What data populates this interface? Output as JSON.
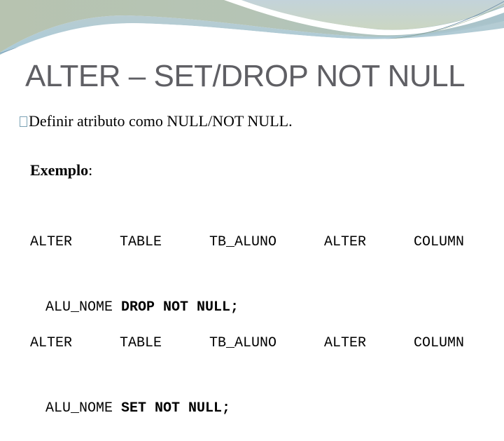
{
  "slide": {
    "title": "ALTER – SET/DROP NOT NULL",
    "bullet": {
      "icon": "square-bullet-icon",
      "text": "Definir atributo como NULL/NOT NULL."
    },
    "example_label": "Exemplo",
    "example_colon": ":",
    "code_blocks": [
      {
        "line1": [
          "ALTER",
          "TABLE",
          "TB_ALUNO",
          "ALTER",
          "COLUMN"
        ],
        "line2_plain": "ALU_NOME ",
        "line2_bold": "DROP NOT NULL;"
      },
      {
        "line1": [
          "ALTER",
          "TABLE",
          "TB_ALUNO",
          "ALTER",
          "COLUMN"
        ],
        "line2_plain": "ALU_NOME ",
        "line2_bold": "SET NOT NULL;"
      }
    ]
  },
  "theme": {
    "title_color": "#5f5f64",
    "bullet_color": "#7aa2b4",
    "wave_colors": [
      "#b9c6b2",
      "#a9c7d3",
      "#c6d6da",
      "#6f8fa8"
    ]
  }
}
